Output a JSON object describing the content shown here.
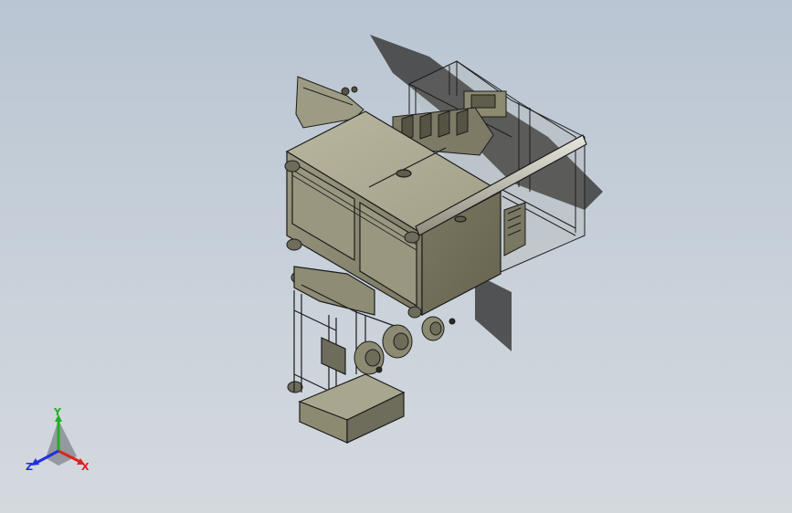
{
  "viewport": {
    "background_top": "#b9c5d2",
    "background_bottom": "#d4d9de"
  },
  "model": {
    "part_color": "#8d8a72",
    "part_dark": "#5f5d4b",
    "part_light": "#b4b19a",
    "edge_color": "#1c1c1c"
  },
  "triad": {
    "x_label": "X",
    "y_label": "Y",
    "z_label": "Z",
    "x_color": "#e02020",
    "y_color": "#20b020",
    "z_color": "#2030e0"
  }
}
